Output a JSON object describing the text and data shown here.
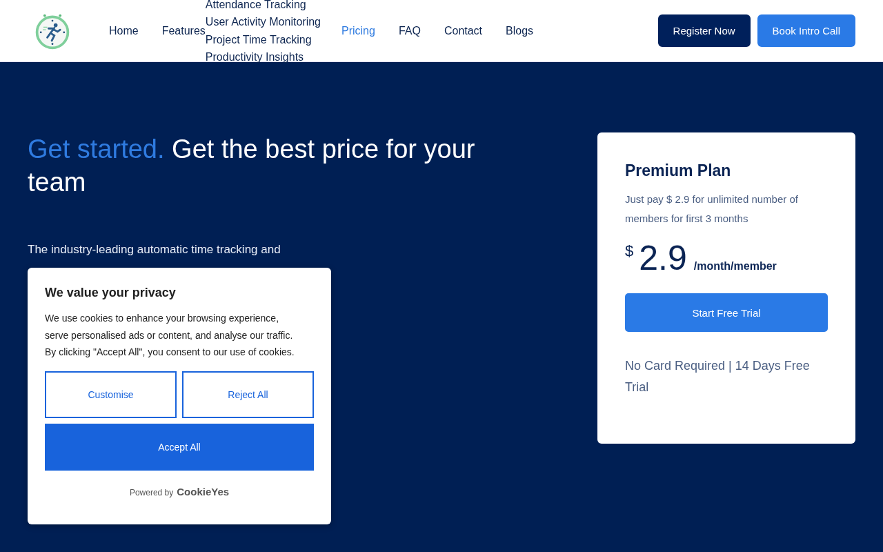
{
  "header": {
    "nav": [
      {
        "label": "Home",
        "selected": false
      },
      {
        "label": "Features",
        "selected": false,
        "submenu": [
          "Attendance Tracking",
          "User Activity Monitoring",
          "Project Time Tracking",
          "Productivity Insights"
        ]
      },
      {
        "label": "Pricing",
        "selected": true
      },
      {
        "label": "FAQ",
        "selected": false
      },
      {
        "label": "Contact",
        "selected": false
      },
      {
        "label": "Blogs",
        "selected": false
      }
    ],
    "buttons": [
      {
        "label": "Register Now",
        "kind": "dark"
      },
      {
        "label": "Book Intro Call",
        "kind": "blue"
      }
    ]
  },
  "hero": {
    "title_accent": "Get started.",
    "title": "Get the best price for your team",
    "paragraph_lines": [
      "The industry-leading automatic time tracking and"
    ]
  },
  "plan": {
    "title": "Premium Plan",
    "description": "Just pay $ 2.9 for unlimited number of members for first 3 months",
    "currency": "$",
    "price": "2.9",
    "unit": "/month/member",
    "button": "Start Free Trial",
    "note": "No Card Required | 14 Days Free Trial"
  },
  "cookie_banner": {
    "title": "We value your privacy",
    "text": "We use cookies to enhance your browsing experience, serve personalised ads or content, and analyse our traffic. By clicking \"Accept All\", you consent to our use of cookies.",
    "buttons": [
      {
        "label": "Customise",
        "kind": "outline"
      },
      {
        "label": "Reject All",
        "kind": "outline"
      },
      {
        "label": "Accept All",
        "kind": "filled"
      }
    ],
    "powered_by": "Powered by",
    "brand": "CookieYes"
  }
}
